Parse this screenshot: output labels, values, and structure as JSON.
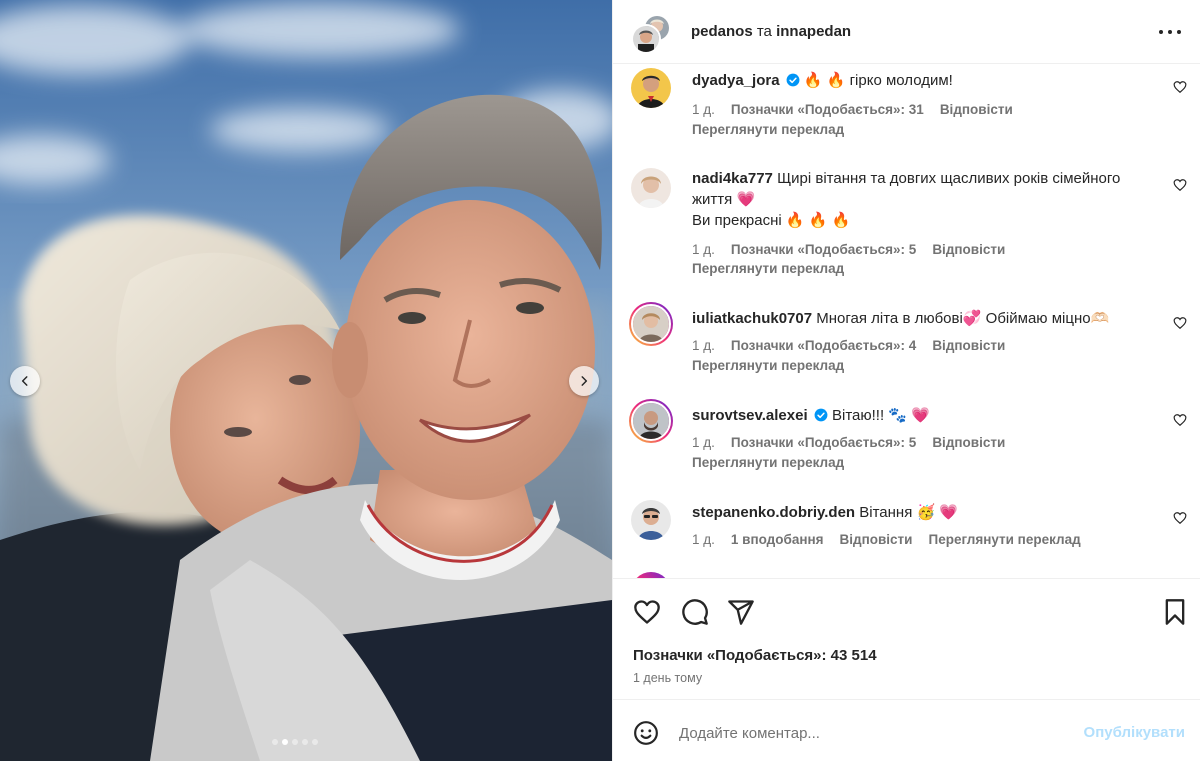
{
  "header": {
    "user1": "pedanos",
    "joiner": "та",
    "user2": "innapedan",
    "more_icon": "more-horizontal-icon"
  },
  "photo": {
    "description_icon": "photo",
    "dots_count": 5,
    "active_dot": 1
  },
  "comments": [
    {
      "username": "dyadya_jora",
      "verified": true,
      "text": "🔥 🔥 гірко молодим!",
      "time": "1 д.",
      "likes": "Позначки «Подобається»: 31",
      "reply": "Відповісти",
      "translate": "Переглянути переклад"
    },
    {
      "username": "nadi4ka777",
      "verified": false,
      "text": "Щирі вітання та довгих щасливих років сімейного життя 💗",
      "text2": "Ви прекрасні 🔥 🔥 🔥",
      "time": "1 д.",
      "likes": "Позначки «Подобається»: 5",
      "reply": "Відповісти",
      "translate": "Переглянути переклад"
    },
    {
      "username": "iuliatkachuk0707",
      "verified": false,
      "text": "Многая літа в любові💞 Обіймаю міцно🫶🏻",
      "time": "1 д.",
      "likes": "Позначки «Подобається»: 4",
      "reply": "Відповісти",
      "translate": "Переглянути переклад"
    },
    {
      "username": "surovtsev.alexei",
      "verified": true,
      "text": "Вітаю!!! 🐾 💗",
      "time": "1 д.",
      "likes": "Позначки «Подобається»: 5",
      "reply": "Відповісти",
      "translate": "Переглянути переклад"
    },
    {
      "username": "stepanenko.dobriy.den",
      "verified": false,
      "text": "Вітання 🥳 💗",
      "time": "1 д.",
      "likes": "1 вподобання",
      "reply": "Відповісти",
      "translate": "Переглянути переклад"
    }
  ],
  "actions": {
    "like_icon": "heart-icon",
    "comment_icon": "comment-icon",
    "share_icon": "send-icon",
    "save_icon": "bookmark-icon",
    "likes_count": "Позначки «Подобається»: 43 514",
    "time": "1 день тому"
  },
  "add_comment": {
    "placeholder": "Додайте коментар...",
    "post_label": "Опублікувати",
    "post_color": "#b2dffc"
  },
  "colors": {
    "text": "#262626",
    "secondary": "#737373",
    "verified": "#0095f6",
    "border": "#efefef"
  }
}
